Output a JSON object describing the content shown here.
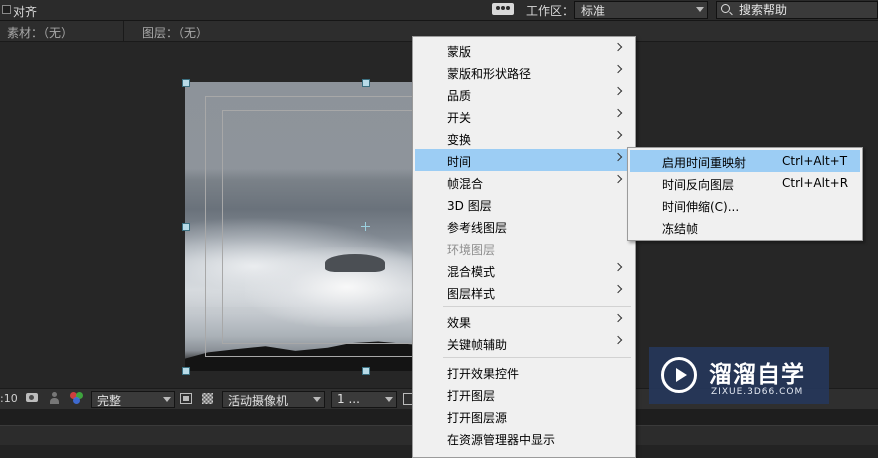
{
  "toolbar": {
    "align_label": "对齐",
    "workspace_label": "工作区：",
    "workspace_value": "标准",
    "search_placeholder": "搜索帮助"
  },
  "panel": {
    "footage_label": "素材：（无）",
    "layer_label": "图层：（无）"
  },
  "viewer_bar": {
    "timecode": ":10",
    "quality_value": "完整",
    "camera_value": "活动摄像机",
    "views_value": "1 ..."
  },
  "context_menu": {
    "items": [
      {
        "label": "蒙版",
        "has_submenu": true
      },
      {
        "label": "蒙版和形状路径",
        "has_submenu": true
      },
      {
        "label": "品质",
        "has_submenu": true
      },
      {
        "label": "开关",
        "has_submenu": true
      },
      {
        "label": "变换",
        "has_submenu": true
      },
      {
        "label": "时间",
        "has_submenu": true,
        "highlighted": true
      },
      {
        "label": "帧混合",
        "has_submenu": true
      },
      {
        "label": "3D 图层",
        "has_submenu": false
      },
      {
        "label": "参考线图层",
        "has_submenu": false
      },
      {
        "label": "环境图层",
        "has_submenu": false,
        "disabled": true
      },
      {
        "label": "混合模式",
        "has_submenu": true
      },
      {
        "label": "图层样式",
        "has_submenu": true
      },
      {
        "label": "效果",
        "has_submenu": true
      },
      {
        "label": "关键帧辅助",
        "has_submenu": true
      },
      {
        "label": "打开效果控件",
        "has_submenu": false
      },
      {
        "label": "打开图层",
        "has_submenu": false
      },
      {
        "label": "打开图层源",
        "has_submenu": false
      },
      {
        "label": "在资源管理器中显示",
        "has_submenu": false
      }
    ]
  },
  "time_submenu": {
    "items": [
      {
        "label": "启用时间重映射",
        "shortcut": "Ctrl+Alt+T",
        "highlighted": true
      },
      {
        "label": "时间反向图层",
        "shortcut": "Ctrl+Alt+R"
      },
      {
        "label": "时间伸缩(C)...",
        "shortcut": ""
      },
      {
        "label": "冻结帧",
        "shortcut": ""
      }
    ]
  },
  "watermark": {
    "title": "溜溜自学",
    "url": "ZIXUE.3D66.COM"
  },
  "colors": {
    "menu_highlight": "#9ccdf4",
    "menu_background": "#f0f0f0",
    "panel_background": "#232323",
    "watermark_background": "#26385c"
  },
  "icons": [
    "checkbox-icon",
    "workspace-icon",
    "search-icon",
    "camera-snapshot-icon",
    "show-snapshot-icon",
    "rgb-channel-icon",
    "region-of-interest-icon",
    "transparency-grid-icon",
    "view-layout-icon",
    "chevron-right-icon",
    "play-logo-icon"
  ]
}
